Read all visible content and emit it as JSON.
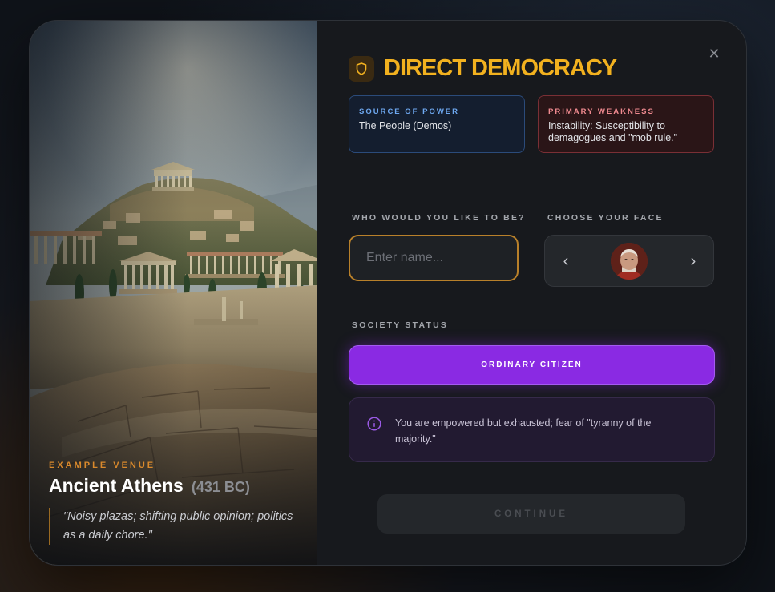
{
  "venue": {
    "eyebrow": "EXAMPLE VENUE",
    "name": "Ancient Athens",
    "year": "(431 BC)",
    "quote": "\"Noisy plazas; shifting public opinion; politics as a daily chore.\""
  },
  "government": {
    "title": "DIRECT DEMOCRACY",
    "icon": "shield-icon",
    "accent_color": "#f2b11f"
  },
  "cards": {
    "power_label": "SOURCE OF POWER",
    "power_text": "The People (Demos)",
    "weakness_label": "PRIMARY WEAKNESS",
    "weakness_text": "Instability: Susceptibility to demagogues and \"mob rule.\""
  },
  "identity": {
    "name_label": "WHO WOULD YOU LIKE TO BE?",
    "name_placeholder": "Enter name...",
    "name_value": "",
    "face_label": "CHOOSE YOUR FACE",
    "prev_icon": "chevron-left-icon",
    "next_icon": "chevron-right-icon"
  },
  "status": {
    "label": "SOCIETY STATUS",
    "selected": "ORDINARY CITIZEN",
    "selected_color": "#8a2ae3",
    "note": "You are empowered but exhausted; fear of \"tyranny of the majority.\""
  },
  "actions": {
    "continue_label": "CONTINUE",
    "close_icon": "close-icon"
  }
}
